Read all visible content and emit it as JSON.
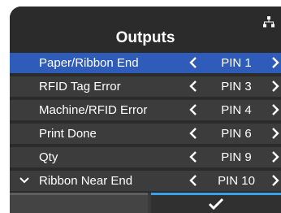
{
  "screen": {
    "title": "Outputs",
    "colors": {
      "background": "#2b2b2b",
      "row": "#3c3c3c",
      "selected_row": "#2e5cb8",
      "ok_accent": "#3aa0e8"
    }
  },
  "status": {
    "icon": "network-icon"
  },
  "items": [
    {
      "label": "Paper/Ribbon End",
      "value": "PIN 1",
      "selected": true
    },
    {
      "label": "RFID Tag Error",
      "value": "PIN 3",
      "selected": false
    },
    {
      "label": "Machine/RFID Error",
      "value": "PIN 4",
      "selected": false
    },
    {
      "label": "Print Done",
      "value": "PIN 6",
      "selected": false
    },
    {
      "label": "Qty",
      "value": "PIN 9",
      "selected": false
    },
    {
      "label": "Ribbon Near End",
      "value": "PIN 10",
      "selected": false
    }
  ],
  "footer": {
    "back_icon": "blank",
    "ok_icon": "checkmark-icon"
  }
}
